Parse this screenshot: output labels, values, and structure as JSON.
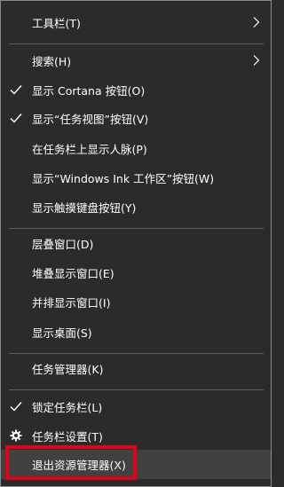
{
  "menu": {
    "items": [
      {
        "label": "工具栏(T)"
      },
      {
        "label": "搜索(H)"
      },
      {
        "label": "显示 Cortana 按钮(O)"
      },
      {
        "label": "显示“任务视图”按钮(V)"
      },
      {
        "label": "在任务栏上显示人脉(P)"
      },
      {
        "label": "显示“Windows Ink 工作区”按钮(W)"
      },
      {
        "label": "显示触摸键盘按钮(Y)"
      },
      {
        "label": "层叠窗口(D)"
      },
      {
        "label": "堆叠显示窗口(E)"
      },
      {
        "label": "并排显示窗口(I)"
      },
      {
        "label": "显示桌面(S)"
      },
      {
        "label": "任务管理器(K)"
      },
      {
        "label": "锁定任务栏(L)"
      },
      {
        "label": "任务栏设置(T)"
      },
      {
        "label": "退出资源管理器(X)"
      }
    ],
    "checked": [
      "显示 Cortana 按钮(O)",
      "显示“任务视图”按钮(V)",
      "锁定任务栏(L)"
    ],
    "highlighted": "退出资源管理器(X)"
  },
  "colors": {
    "background": "#2b2b2b",
    "border": "#8a8a8a",
    "separator": "#5f5f5f",
    "highlight": "#414141",
    "annotation": "#e3001b",
    "text": "#ffffff"
  },
  "icons": {
    "submenu": "chevron-right-icon",
    "check": "checkmark-icon",
    "settings": "gear-icon"
  }
}
